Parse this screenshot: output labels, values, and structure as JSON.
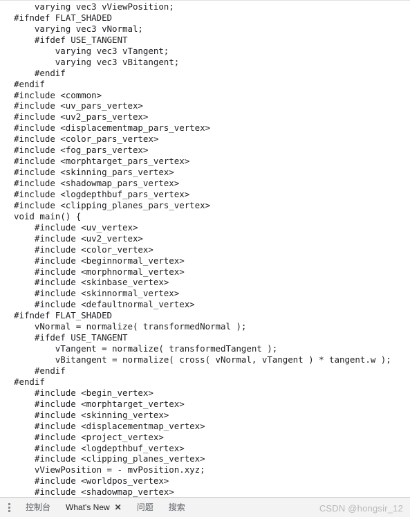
{
  "window": {
    "background_color": "#ffffff",
    "text_color": "#202124"
  },
  "code": {
    "language": "glsl",
    "filename_hint": "meshphysical_vert",
    "lines": [
      "    varying vec3 vViewPosition;",
      "#ifndef FLAT_SHADED",
      "    varying vec3 vNormal;",
      "    #ifdef USE_TANGENT",
      "        varying vec3 vTangent;",
      "        varying vec3 vBitangent;",
      "    #endif",
      "#endif",
      "#include <common>",
      "#include <uv_pars_vertex>",
      "#include <uv2_pars_vertex>",
      "#include <displacementmap_pars_vertex>",
      "#include <color_pars_vertex>",
      "#include <fog_pars_vertex>",
      "#include <morphtarget_pars_vertex>",
      "#include <skinning_pars_vertex>",
      "#include <shadowmap_pars_vertex>",
      "#include <logdepthbuf_pars_vertex>",
      "#include <clipping_planes_pars_vertex>",
      "void main() {",
      "    #include <uv_vertex>",
      "    #include <uv2_vertex>",
      "    #include <color_vertex>",
      "    #include <beginnormal_vertex>",
      "    #include <morphnormal_vertex>",
      "    #include <skinbase_vertex>",
      "    #include <skinnormal_vertex>",
      "    #include <defaultnormal_vertex>",
      "#ifndef FLAT_SHADED",
      "    vNormal = normalize( transformedNormal );",
      "    #ifdef USE_TANGENT",
      "        vTangent = normalize( transformedTangent );",
      "        vBitangent = normalize( cross( vNormal, vTangent ) * tangent.w );",
      "    #endif",
      "#endif",
      "    #include <begin_vertex>",
      "    #include <morphtarget_vertex>",
      "    #include <skinning_vertex>",
      "    #include <displacementmap_vertex>",
      "    #include <project_vertex>",
      "    #include <logdepthbuf_vertex>",
      "    #include <clipping_planes_vertex>",
      "    vViewPosition = - mvPosition.xyz;",
      "    #include <worldpos_vertex>",
      "    #include <shadowmap_vertex>"
    ]
  },
  "drawer": {
    "menu_icon": "more-vertical-icon",
    "tabs": [
      {
        "label": "控制台",
        "closable": false,
        "selected": false
      },
      {
        "label": "What's New",
        "closable": true,
        "selected": true,
        "close_glyph": "✕"
      },
      {
        "label": "问题",
        "closable": false,
        "selected": false
      },
      {
        "label": "搜索",
        "closable": false,
        "selected": false
      }
    ]
  },
  "watermark": {
    "text": "CSDN @hongsir_12"
  }
}
